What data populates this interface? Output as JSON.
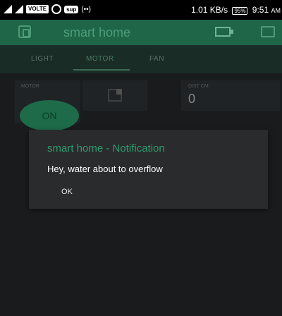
{
  "status_bar": {
    "volte": "VOLTE",
    "hd_badge": "sup",
    "radio": "(••)",
    "data_speed": "1.01 KB/s",
    "battery": "95%",
    "time": "9:51",
    "ampm": "AM"
  },
  "header": {
    "title": "smart home"
  },
  "tabs": [
    {
      "label": "LIGHT"
    },
    {
      "label": "MOTOR"
    },
    {
      "label": "FAN"
    }
  ],
  "widgets": {
    "motor": {
      "label": "MOTOR",
      "button": "ON"
    },
    "dist": {
      "label": "DIST CM",
      "value": "0"
    }
  },
  "dialog": {
    "title": "smart home - Notification",
    "message": "Hey, water about to overflow",
    "ok": "OK"
  },
  "colors": {
    "accent": "#2f9a6e",
    "header_bg": "#1f6648",
    "dialog_bg": "#2a2b2d"
  }
}
